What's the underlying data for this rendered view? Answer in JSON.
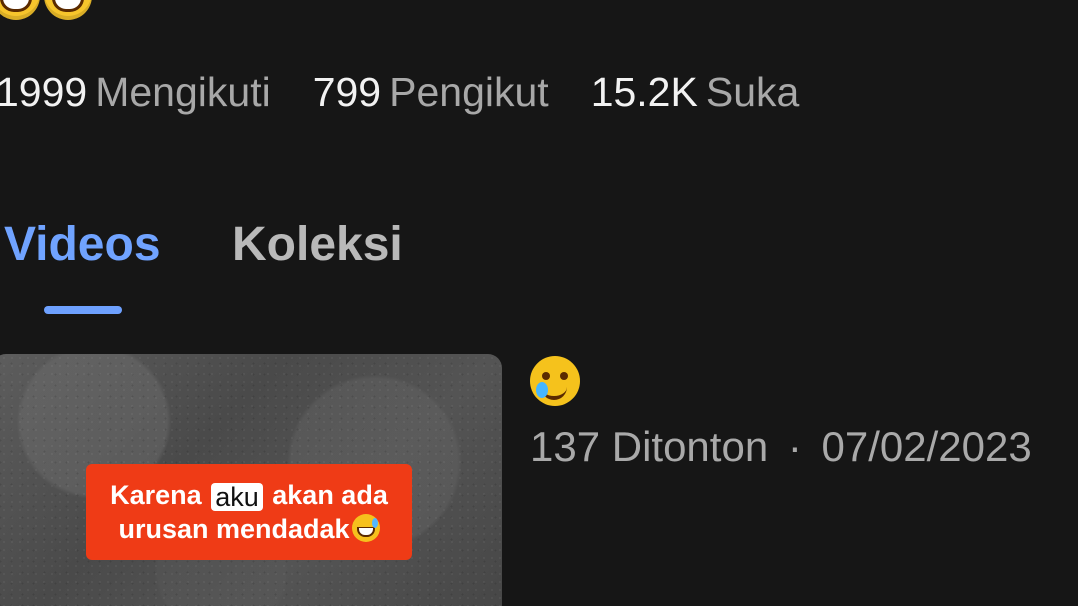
{
  "profile": {
    "stats": [
      {
        "value": "1999",
        "label": "Mengikuti"
      },
      {
        "value": "799",
        "label": "Pengikut"
      },
      {
        "value": "15.2K",
        "label": "Suka"
      }
    ]
  },
  "tabs": [
    {
      "label": "Videos",
      "active": true
    },
    {
      "label": "Koleksi",
      "active": false
    }
  ],
  "video": {
    "thumbnail_caption_line_1_before": "Karena",
    "thumbnail_caption_sticker": "aku",
    "thumbnail_caption_line_1_after": "akan ada",
    "thumbnail_caption_line_2": "urusan mendadak",
    "views": "137 Ditonton",
    "separator": "·",
    "date": "07/02/2023"
  },
  "icons": {
    "top_emoji_1": "grinning-face-icon",
    "top_emoji_2": "grinning-sweat-face-icon",
    "caption_emoji": "grinning-sweat-face-icon",
    "title_emoji": "smiling-tear-face-icon"
  }
}
